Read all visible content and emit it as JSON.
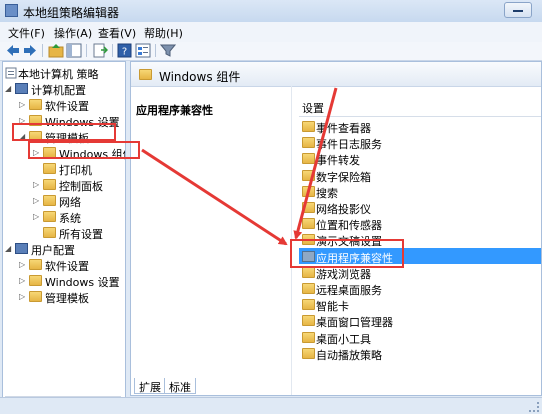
{
  "window": {
    "title": "本地组策略编辑器"
  },
  "menu": [
    {
      "label": "文件(F)"
    },
    {
      "label": "操作(A)"
    },
    {
      "label": "查看(V)"
    },
    {
      "label": "帮助(H)"
    }
  ],
  "toolbar_icons": [
    "back-arrow-icon",
    "forward-arrow-icon",
    "up-folder-icon",
    "show-hide-tree-icon",
    "export-list-icon",
    "help-icon",
    "properties-icon",
    "filter-icon"
  ],
  "tree": {
    "root": "本地计算机 策略",
    "computer_config": "计算机配置",
    "software_settings": "软件设置",
    "windows_settings": "Windows 设置",
    "admin_templates": "管理模板",
    "windows_components": "Windows 组件",
    "printers": "打印机",
    "control_panel": "控制面板",
    "network": "网络",
    "system": "系统",
    "all_settings": "所有设置",
    "user_config": "用户配置",
    "user_software_settings": "软件设置",
    "user_windows_settings": "Windows 设置",
    "user_admin_templates": "管理模板"
  },
  "right": {
    "header": "Windows 组件",
    "section_title": "应用程序兼容性",
    "column_header": "设置",
    "items": [
      "事件查看器",
      "事件日志服务",
      "事件转发",
      "数字保险箱",
      "搜索",
      "网络投影仪",
      "位置和传感器",
      "演示文稿设置",
      "应用程序兼容性",
      "游戏浏览器",
      "远程桌面服务",
      "智能卡",
      "桌面窗口管理器",
      "桌面小工具",
      "自动播放策略"
    ],
    "selected_item": "应用程序兼容性"
  },
  "tabs": [
    {
      "label": "扩展"
    },
    {
      "label": "标准"
    }
  ],
  "colors": {
    "selection": "#3399ff",
    "annotation": "#e53935",
    "folder": "#e6b545"
  }
}
